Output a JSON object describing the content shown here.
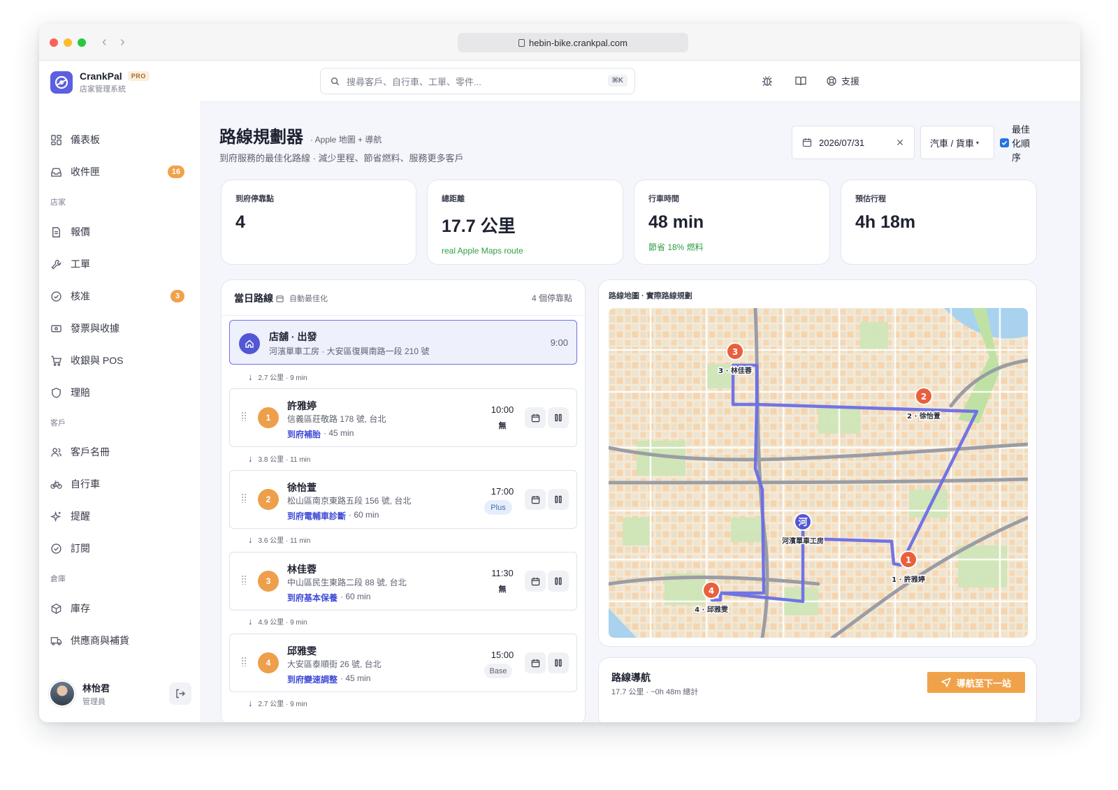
{
  "browser": {
    "url": "hebin-bike.crankpal.com",
    "colors": {
      "close": "#fe5f57",
      "minimize": "#febc2e",
      "maximize": "#28c840"
    }
  },
  "brand": {
    "name": "CrankPal",
    "badge": "PRO",
    "subtitle": "店家管理系統",
    "accent": "#5b5fe0"
  },
  "sidebar": {
    "items": [
      {
        "label": "儀表板",
        "icon": "dashboard-icon"
      },
      {
        "label": "收件匣",
        "icon": "inbox-icon",
        "badge": "16"
      },
      {
        "label": "報價",
        "icon": "document-icon"
      },
      {
        "label": "工單",
        "icon": "wrench-icon"
      },
      {
        "label": "核准",
        "icon": "check-circle-icon",
        "badge": "3"
      },
      {
        "label": "發票與收據",
        "icon": "receipt-icon"
      },
      {
        "label": "收銀與 POS",
        "icon": "cart-icon"
      },
      {
        "label": "理賠",
        "icon": "shield-icon"
      },
      {
        "label": "客戶名冊",
        "icon": "users-icon"
      },
      {
        "label": "自行車",
        "icon": "bike-icon"
      },
      {
        "label": "提醒",
        "icon": "sparkle-icon"
      },
      {
        "label": "訂閱",
        "icon": "check-circle-icon"
      },
      {
        "label": "庫存",
        "icon": "box-icon"
      },
      {
        "label": "供應商與補貨",
        "icon": "truck-icon"
      }
    ],
    "sections": {
      "store": "店家",
      "customers": "客戶",
      "warehouse": "倉庫"
    },
    "user": {
      "name": "林怡君",
      "role": "管理員"
    }
  },
  "topbar": {
    "search_placeholder": "搜尋客戶、自行車、工單、零件...",
    "search_shortcut": "⌘K",
    "support_label": "支援"
  },
  "page": {
    "title": "路線規劃器",
    "title_note": "· Apple 地圖 + 導航",
    "subtitle": "到府服務的最佳化路線 · 減少里程、節省燃料、服務更多客戶",
    "date": "2026/07/31",
    "vehicle": "汽車 / 貨車",
    "optimize_label": "最佳化順序",
    "optimize_checked": true
  },
  "stats": [
    {
      "label": "到府停靠點",
      "value": "4",
      "note": ""
    },
    {
      "label": "總距離",
      "value": "17.7 公里",
      "note": "real Apple Maps route"
    },
    {
      "label": "行車時間",
      "value": "48 min",
      "note": "節省 18% 燃料"
    },
    {
      "label": "預估行程",
      "value": "4h 18m",
      "note": ""
    }
  ],
  "route": {
    "title": "當日路線",
    "auto_label": "自動最佳化",
    "count": "4 個停靠點",
    "start": {
      "name": "店舖 · 出發",
      "address": "河濱單車工房 · 大安區復興南路一段 210 號",
      "time": "9:00"
    },
    "legs": [
      "2.7 公里 · 9 min",
      "3.8 公里 · 11 min",
      "3.6 公里 · 11 min",
      "4.9 公里 · 9 min",
      "2.7 公里 · 9 min"
    ],
    "stops": [
      {
        "n": "1",
        "name": "許雅婷",
        "address": "信義區莊敬路 178 號, 台北",
        "service": "到府補胎",
        "duration": "· 45 min",
        "time": "10:00",
        "tag": "無",
        "tag_style": "plain"
      },
      {
        "n": "2",
        "name": "徐怡萱",
        "address": "松山區南京東路五段 156 號, 台北",
        "service": "到府電輔車診斷",
        "duration": "· 60 min",
        "time": "17:00",
        "tag": "Plus",
        "tag_style": "blue"
      },
      {
        "n": "3",
        "name": "林佳蓉",
        "address": "中山區民生東路二段 88 號, 台北",
        "service": "到府基本保養",
        "duration": "· 60 min",
        "time": "11:30",
        "tag": "無",
        "tag_style": "plain"
      },
      {
        "n": "4",
        "name": "邱雅雯",
        "address": "大安區泰順街 26 號, 台北",
        "service": "到府變速調整",
        "duration": "· 45 min",
        "time": "15:00",
        "tag": "Base",
        "tag_style": "gray"
      }
    ]
  },
  "map": {
    "title": "路線地圖 · 實際路線規劃",
    "shop_marker": "河",
    "shop_label": "河濱單車工房",
    "labels": [
      "1 · 許雅婷",
      "2 · 徐怡萱",
      "3 · 林佳蓉",
      "4 · 邱雅雯"
    ],
    "route_color": "#6a6ee6",
    "stop_marker_color": "#e8603c"
  },
  "navigation": {
    "title": "路線導航",
    "summary": "17.7 公里 · ~0h 48m 總計",
    "button_label": "導航至下一站"
  }
}
